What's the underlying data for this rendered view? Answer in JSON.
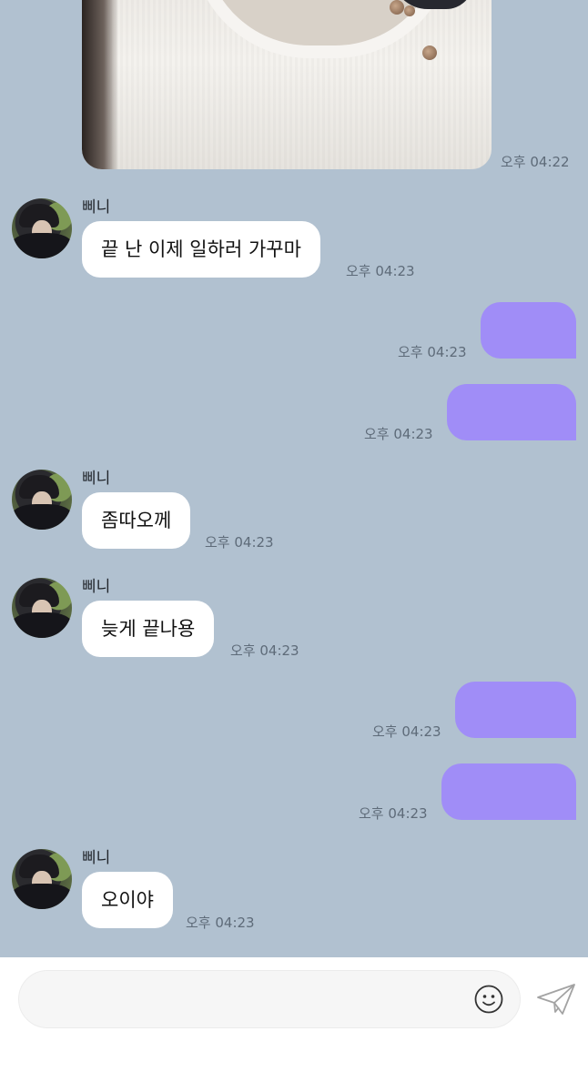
{
  "chat": {
    "photo_time": "오후 04:22",
    "messages": [
      {
        "sender": "삐니",
        "text": "끝 난 이제 일하러 가꾸마",
        "time": "오후 04:23"
      },
      {
        "sent_time": "오후 04:23"
      },
      {
        "sent_time": "오후 04:23"
      },
      {
        "sender": "삐니",
        "text": "좀따오께",
        "time": "오후 04:23"
      },
      {
        "sender": "삐니",
        "text": "늦게 끝나용",
        "time": "오후 04:23"
      },
      {
        "sent_time": "오후 04:23"
      },
      {
        "sent_time": "오후 04:23"
      },
      {
        "sender": "삐니",
        "text": "오이야",
        "time": "오후 04:23"
      }
    ]
  },
  "composer": {
    "placeholder": "",
    "emoji_icon": "smiley-icon",
    "send_icon": "paper-plane-icon"
  },
  "colors": {
    "background": "#b1c1d0",
    "incoming_bubble": "#ffffff",
    "outgoing_bubble": "#a08df7"
  }
}
